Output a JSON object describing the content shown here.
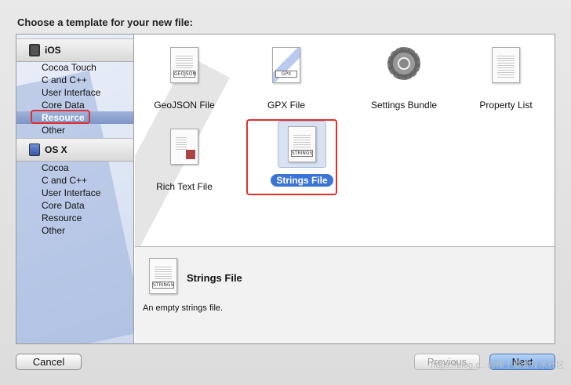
{
  "dialog": {
    "title": "Choose a template for your new file:"
  },
  "sidebar": {
    "groups": [
      {
        "name": "iOS",
        "icon": "ios-device-icon",
        "items": [
          "Cocoa Touch",
          "C and C++",
          "User Interface",
          "Core Data",
          "Resource",
          "Other"
        ]
      },
      {
        "name": "OS X",
        "icon": "mac-icon",
        "items": [
          "Cocoa",
          "C and C++",
          "User Interface",
          "Core Data",
          "Resource",
          "Other"
        ]
      }
    ],
    "selected": "Resource"
  },
  "templates": [
    {
      "label": "GeoJSON File",
      "icon": "geojson-icon",
      "badge": "GEOJSON"
    },
    {
      "label": "GPX File",
      "icon": "gpx-icon",
      "badge": "GPX"
    },
    {
      "label": "Settings Bundle",
      "icon": "settings-gear-icon"
    },
    {
      "label": "Property List",
      "icon": "property-list-icon"
    },
    {
      "label": "Rich Text File",
      "icon": "rich-text-icon"
    },
    {
      "label": "Strings File",
      "icon": "strings-icon",
      "badge": "STRINGS",
      "selected": true
    }
  ],
  "detail": {
    "title": "Strings File",
    "badge": "STRINGS",
    "description": "An empty strings file."
  },
  "buttons": {
    "cancel": "Cancel",
    "previous": "Previous",
    "next": "Next"
  },
  "watermark": "https://blog.c...@稀土掘金技术社区",
  "colors": {
    "selection": "#3b76d6",
    "highlight": "#e03030"
  }
}
